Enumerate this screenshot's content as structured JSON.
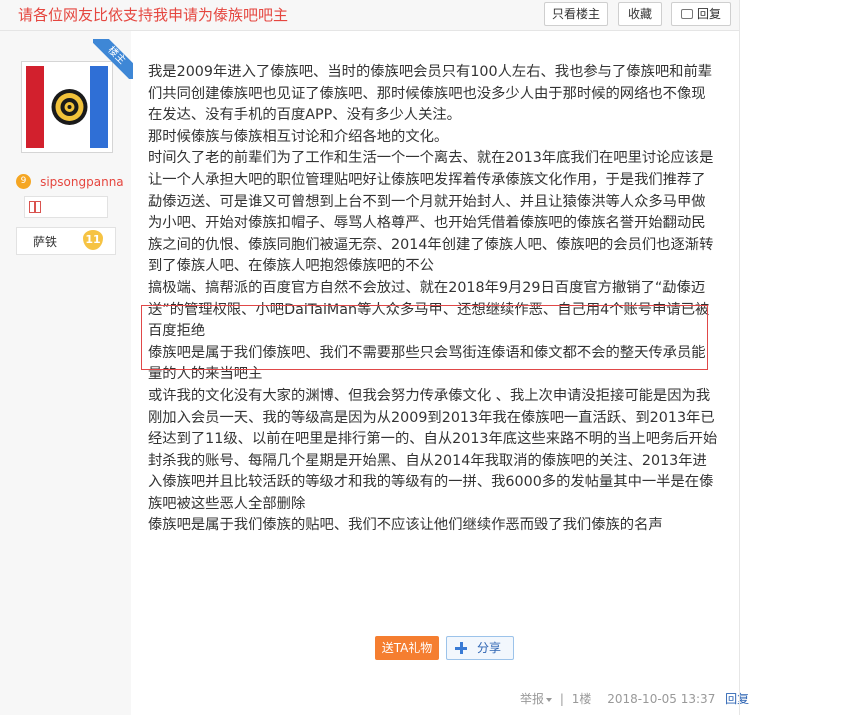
{
  "header": {
    "title": "请各位网友比依支持我申请为傣族吧吧主",
    "buttons": {
      "only_op": "只看楼主",
      "favorite": "收藏",
      "reply": "回复"
    }
  },
  "author": {
    "corner_badge": "楼主",
    "level_badge": "9",
    "username": "sipsongpanna",
    "title": "萨铁",
    "level": "11"
  },
  "post": {
    "paragraphs": [
      "我是2009年进入了傣族吧、当时的傣族吧会员只有100人左右、我也参与了傣族吧和前辈们共同创建傣族吧也见证了傣族吧、那时候傣族吧也没多少人由于那时候的网络也不像现在发达、没有手机的百度APP、没有多少人关注。",
      "那时候傣族与傣族相互讨论和介绍各地的文化。",
      "时间久了老的前辈们为了工作和生活一个一个离去、就在2013年底我们在吧里讨论应该是让一个人承担大吧的职位管理贴吧好让傣族吧发挥着传承傣族文化作用，于是我们推荐了勐傣迈送、可是谁又可曾想到上台不到一个月就开始封人、并且让猿傣洪等人众多马甲做为小吧、开始对傣族扣帽子、辱骂人格尊严、也开始凭借着傣族吧的傣族名誉开始翻动民族之间的仇恨、傣族同胞们被逼无奈、2014年创建了傣族人吧、傣族吧的会员们也逐渐转到了傣族人吧、在傣族人吧抱怨傣族吧的不公",
      "搞极端、搞帮派的百度官方自然不会放过、就在2018年9月29日百度官方撤销了“勐傣迈送”的管理权限、小吧DaiTaiMan等人众多马甲、还想继续作恶、自己用4个账号申请已被百度拒绝",
      "傣族吧是属于我们傣族吧、我们不需要那些只会骂街连傣语和傣文都不会的整天传承员能量的人的来当吧主",
      "或许我的文化没有大家的渊博、但我会努力传承傣文化 、我上次申请没拒接可能是因为我刚加入会员一天、我的等级高是因为从2009到2013年我在傣族吧一直活跃、到2013年已经达到了11级、以前在吧里是排行第一的、自从2013年底这些来路不明的当上吧务后开始封杀我的账号、每隔几个星期是开始黑、自从2014年我取消的傣族吧的关注、2013年进入傣族吧并且比较活跃的等级才和我的等级有的一拼、我6000多的发帖量其中一半是在傣族吧被这些恶人全部删除",
      "傣族吧是属于我们傣族的贴吧、我们不应该让他们继续作恶而毁了我们傣族的名声"
    ]
  },
  "actions": {
    "gift": "送TA礼物",
    "share": "分享"
  },
  "meta": {
    "report": "举报",
    "floor": "1楼",
    "timestamp": "2018-10-05 13:37",
    "reply": "回复",
    "separator": "|"
  },
  "colors": {
    "title_red": "#e5463f",
    "gift_orange": "#f57e30",
    "link_blue": "#2d64b3",
    "highlight_border": "#e04848"
  }
}
